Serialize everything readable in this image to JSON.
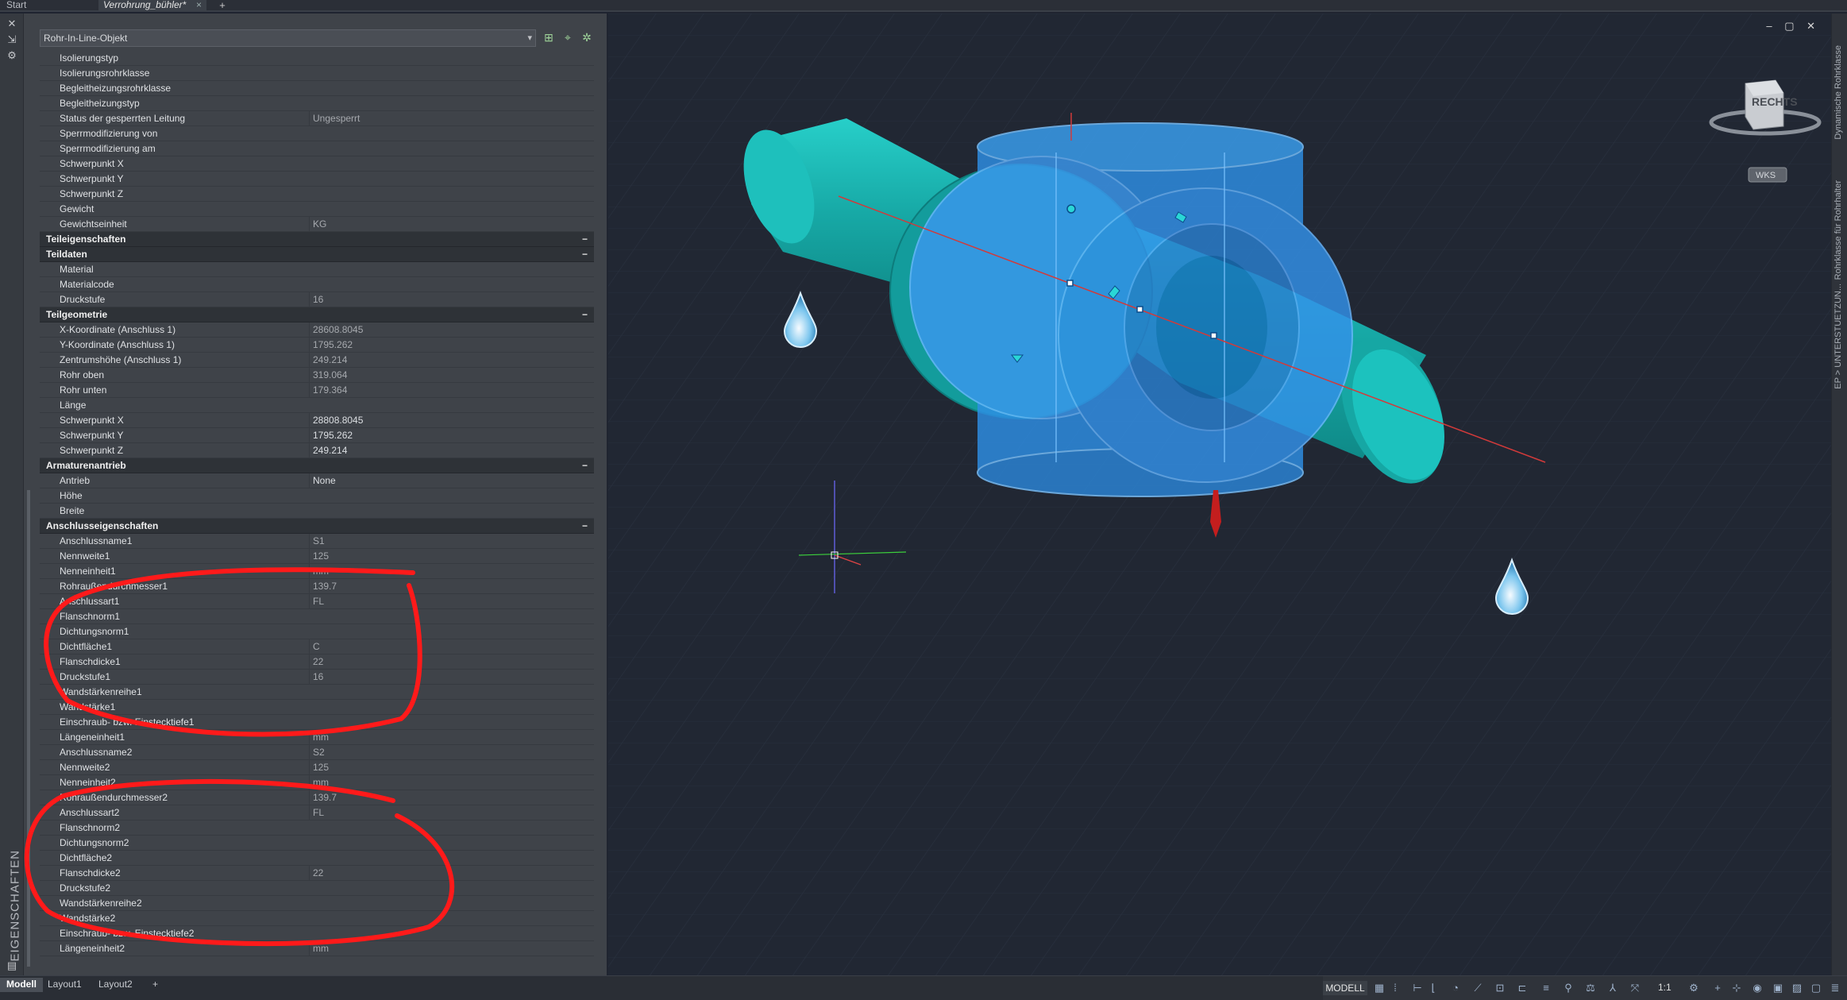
{
  "file_tabs": {
    "start": "Start",
    "document": "Verrohrung_bühler*",
    "close_glyph": "×",
    "add_glyph": "+"
  },
  "palette": {
    "strip_title": "EIGENSCHAFTEN",
    "object_selector": "Rohr-In-Line-Objekt",
    "rows_top": [
      {
        "label": "Isolierungstyp",
        "value": ""
      },
      {
        "label": "Isolierungsrohrklasse",
        "value": ""
      },
      {
        "label": "Begleitheizungsrohrklasse",
        "value": ""
      },
      {
        "label": "Begleitheizungstyp",
        "value": ""
      },
      {
        "label": "Status der gesperrten Leitung",
        "value": "Ungesperrt"
      },
      {
        "label": "Sperrmodifizierung von",
        "value": ""
      },
      {
        "label": "Sperrmodifizierung am",
        "value": ""
      },
      {
        "label": "Schwerpunkt X",
        "value": ""
      },
      {
        "label": "Schwerpunkt Y",
        "value": ""
      },
      {
        "label": "Schwerpunkt Z",
        "value": ""
      },
      {
        "label": "Gewicht",
        "value": ""
      },
      {
        "label": "Gewichtseinheit",
        "value": "KG"
      }
    ],
    "sec_teileigenschaften": "Teileigenschaften",
    "sec_teildaten": "Teildaten",
    "rows_teildaten": [
      {
        "label": "Material",
        "value": ""
      },
      {
        "label": "Materialcode",
        "value": ""
      },
      {
        "label": "Druckstufe",
        "value": "16"
      }
    ],
    "sec_teilgeometrie": "Teilgeometrie",
    "rows_teilgeometrie": [
      {
        "label": "X-Koordinate (Anschluss 1)",
        "value": "28608.8045"
      },
      {
        "label": "Y-Koordinate (Anschluss 1)",
        "value": "1795.262"
      },
      {
        "label": "Zentrumshöhe (Anschluss 1)",
        "value": "249.214"
      },
      {
        "label": "Rohr oben",
        "value": "319.064"
      },
      {
        "label": "Rohr unten",
        "value": "179.364"
      },
      {
        "label": "Länge",
        "value": ""
      },
      {
        "label": "Schwerpunkt X",
        "value": "28808.8045"
      },
      {
        "label": "Schwerpunkt Y",
        "value": "1795.262"
      },
      {
        "label": "Schwerpunkt Z",
        "value": "249.214"
      }
    ],
    "sec_armaturenantrieb": "Armaturenantrieb",
    "rows_armaturenantrieb": [
      {
        "label": "Antrieb",
        "value": "None"
      },
      {
        "label": "Höhe",
        "value": ""
      },
      {
        "label": "Breite",
        "value": ""
      }
    ],
    "sec_anschlusseigenschaften": "Anschlusseigenschaften",
    "rows_anschluss": [
      {
        "label": "Anschlussname1",
        "value": "S1"
      },
      {
        "label": "Nennweite1",
        "value": "125"
      },
      {
        "label": "Nenneinheit1",
        "value": "mm"
      },
      {
        "label": "Rohraußendurchmesser1",
        "value": "139.7"
      },
      {
        "label": "Anschlussart1",
        "value": "FL"
      },
      {
        "label": "Flanschnorm1",
        "value": ""
      },
      {
        "label": "Dichtungsnorm1",
        "value": ""
      },
      {
        "label": "Dichtfläche1",
        "value": "C"
      },
      {
        "label": "Flanschdicke1",
        "value": "22"
      },
      {
        "label": "Druckstufe1",
        "value": "16"
      },
      {
        "label": "Wandstärkenreihe1",
        "value": ""
      },
      {
        "label": "Wandstärke1",
        "value": ""
      },
      {
        "label": "Einschraub- bzw. Einstecktiefe1",
        "value": ""
      },
      {
        "label": "Längeneinheit1",
        "value": "mm"
      },
      {
        "label": "Anschlussname2",
        "value": "S2"
      },
      {
        "label": "Nennweite2",
        "value": "125"
      },
      {
        "label": "Nenneinheit2",
        "value": "mm"
      },
      {
        "label": "Rohraußendurchmesser2",
        "value": "139.7"
      },
      {
        "label": "Anschlussart2",
        "value": "FL"
      },
      {
        "label": "Flanschnorm2",
        "value": ""
      },
      {
        "label": "Dichtungsnorm2",
        "value": ""
      },
      {
        "label": "Dichtfläche2",
        "value": ""
      },
      {
        "label": "Flanschdicke2",
        "value": "22"
      },
      {
        "label": "Druckstufe2",
        "value": ""
      },
      {
        "label": "Wandstärkenreihe2",
        "value": ""
      },
      {
        "label": "Wandstärke2",
        "value": ""
      },
      {
        "label": "Einschraub- bzw. Einstecktiefe2",
        "value": ""
      },
      {
        "label": "Längeneinheit2",
        "value": "mm"
      }
    ],
    "collapse_glyph": "−"
  },
  "viewport": {
    "viewcube_label": "RECHTS",
    "ucs_label": "WKS",
    "window_controls": "–  ▢  ✕",
    "right_tabs": [
      "Dynamische Rohrklasse",
      "Rohrklasse für Rohrhalter",
      "EP > UNTERSTUETZUN..."
    ],
    "colors": {
      "background": "#212733",
      "pipe": "#1fb5b3",
      "valve_body": "#2e8fe6",
      "centerline": "#d23a3a",
      "annotation_red": "#ff1a1a"
    }
  },
  "layout_tabs": {
    "model": "Modell",
    "layout1": "Layout1",
    "layout2": "Layout2",
    "add": "+"
  },
  "status_bar": {
    "model_button": "MODELL",
    "scale": "1:1"
  }
}
